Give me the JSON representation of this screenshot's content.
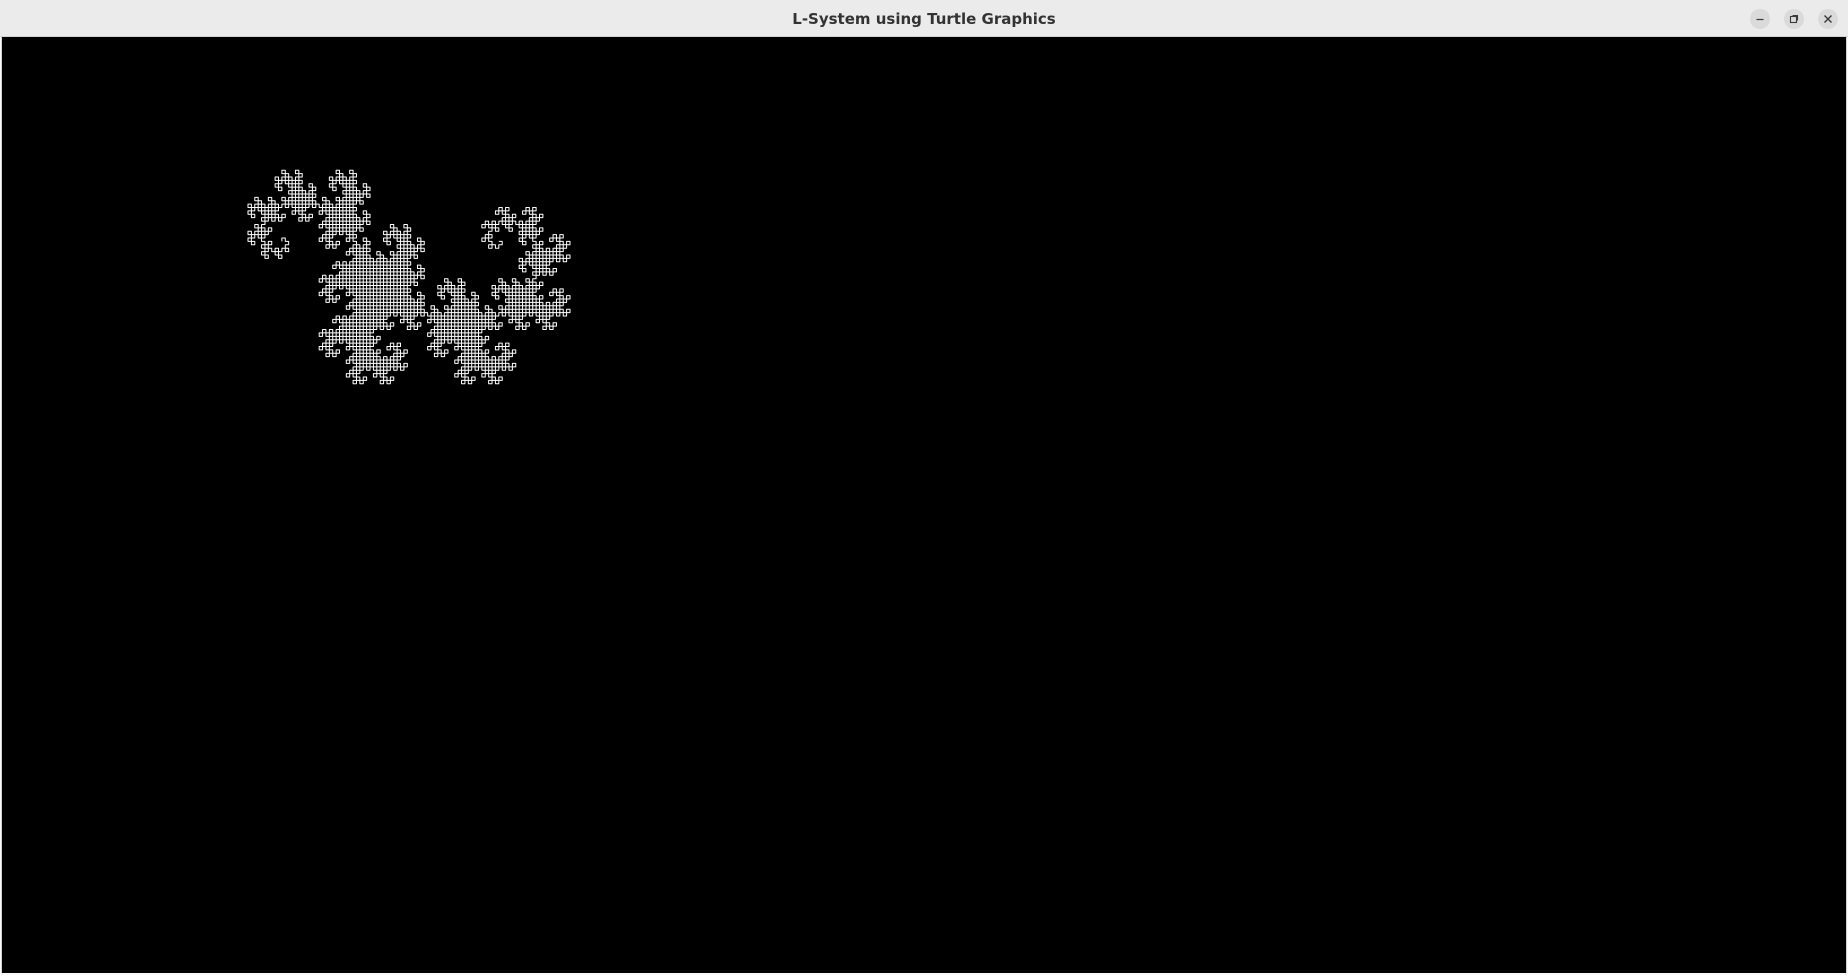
{
  "window": {
    "title": "L-System using Turtle Graphics",
    "controls": [
      "minimize-icon",
      "restore-icon",
      "close-icon"
    ]
  },
  "canvas": {
    "background": "#000000",
    "stroke_color": "#ffffff",
    "figure": "dragon-curve-fractal"
  }
}
